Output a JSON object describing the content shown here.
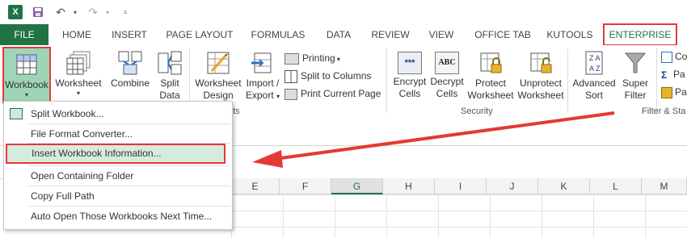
{
  "app": {
    "brand_color": "#217346",
    "highlight_red": "#e53935"
  },
  "qat": {
    "icons": [
      "excel-app-icon",
      "save-icon",
      "undo-icon",
      "redo-icon",
      "customize-qat-icon"
    ]
  },
  "tabs": [
    "FILE",
    "HOME",
    "INSERT",
    "PAGE LAYOUT",
    "FORMULAS",
    "DATA",
    "REVIEW",
    "VIEW",
    "OFFICE TAB",
    "KUTOOLS",
    "ENTERPRISE"
  ],
  "ribbon": {
    "workbook": {
      "label": "Workbook"
    },
    "worksheet": {
      "label": "Worksheet"
    },
    "combine": {
      "label": "Combine"
    },
    "split_data": {
      "line1": "Split",
      "line2": "Data"
    },
    "worksheet_design": {
      "line1": "Worksheet",
      "line2": "Design"
    },
    "import_export": {
      "line1": "Import /",
      "line2": "Export"
    },
    "printing": {
      "label": "Printing"
    },
    "split_to_columns": {
      "label": "Split to Columns"
    },
    "print_current_page": {
      "label": "Print Current Page"
    },
    "encrypt_cells": {
      "line1": "Encrypt",
      "line2": "Cells"
    },
    "decrypt_cells": {
      "line1": "Decrypt",
      "line2": "Cells"
    },
    "protect_worksheet": {
      "line1": "Protect",
      "line2": "Worksheet"
    },
    "unprotect_worksheet": {
      "line1": "Unprotect",
      "line2": "Worksheet"
    },
    "advanced_sort": {
      "line1": "Advanced",
      "line2": "Sort"
    },
    "super_filter": {
      "line1": "Super",
      "line2": "Filter"
    },
    "co_partial": {
      "label": "Co"
    },
    "pa_partial1": {
      "label": "Pa"
    },
    "pa_partial2": {
      "label": "Pa"
    },
    "group_ets": {
      "label": "ets"
    },
    "group_security": {
      "label": "Security"
    },
    "group_filter_sort": {
      "label": "Filter & Sta"
    },
    "encrypt_icon_text": "***",
    "decrypt_icon_text": "ABC"
  },
  "menu": {
    "items": [
      {
        "label": "Split Workbook..."
      },
      {
        "label": "File Format Converter..."
      },
      {
        "label": "Insert Workbook Information..."
      },
      {
        "label": "Open Containing Folder"
      },
      {
        "label": "Copy Full Path"
      },
      {
        "label": "Auto Open Those Workbooks Next Time..."
      }
    ]
  },
  "columns": [
    "E",
    "F",
    "G",
    "H",
    "I",
    "J",
    "K",
    "L",
    "M"
  ]
}
